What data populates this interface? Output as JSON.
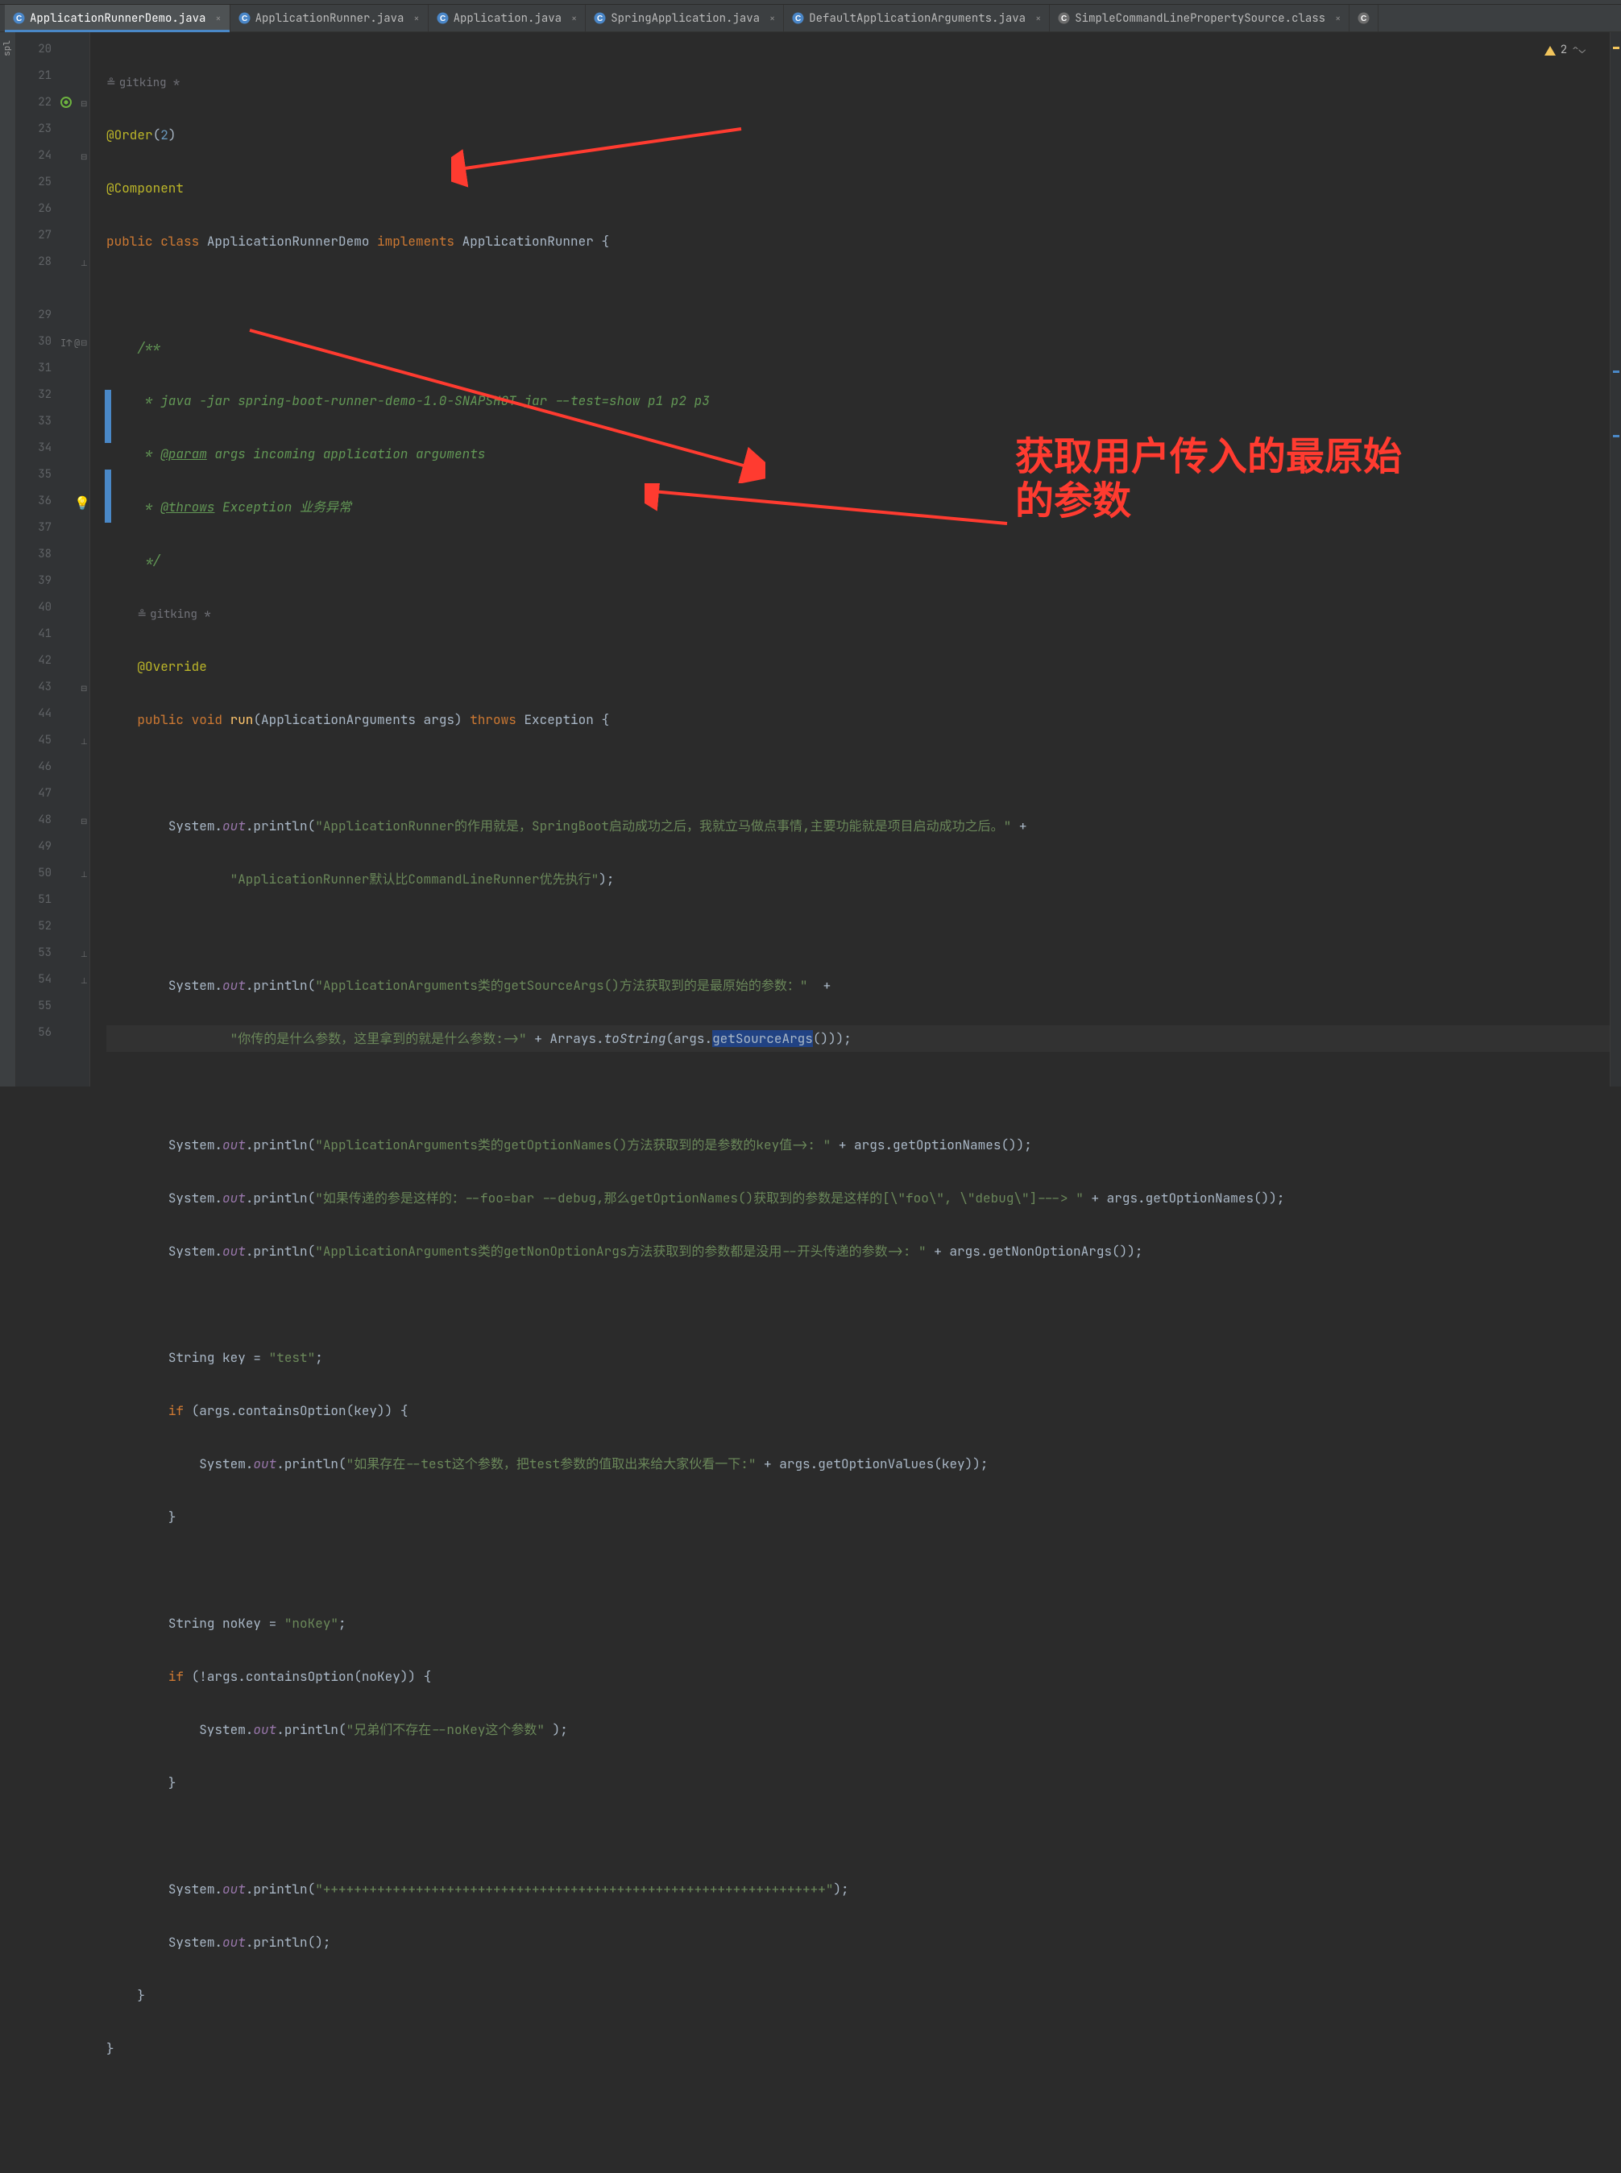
{
  "tabs": [
    {
      "label": "ApplicationRunnerDemo.java",
      "active": true,
      "pinned": true,
      "icon": "class"
    },
    {
      "label": "ApplicationRunner.java",
      "active": false,
      "pinned": false,
      "icon": "class"
    },
    {
      "label": "Application.java",
      "active": false,
      "pinned": false,
      "icon": "class"
    },
    {
      "label": "SpringApplication.java",
      "active": false,
      "pinned": false,
      "icon": "class"
    },
    {
      "label": "DefaultApplicationArguments.java",
      "active": false,
      "pinned": false,
      "icon": "class"
    },
    {
      "label": "SimpleCommandLinePropertySource.class",
      "active": false,
      "pinned": false,
      "icon": "lib"
    }
  ],
  "inspection": {
    "warnings": "2"
  },
  "left_tool": "spl",
  "gutter_lines": [
    "20",
    "21",
    "22",
    "23",
    "24",
    "25",
    "26",
    "27",
    "28",
    "",
    "29",
    "30",
    "31",
    "32",
    "33",
    "34",
    "35",
    "36",
    "37",
    "38",
    "39",
    "40",
    "41",
    "42",
    "43",
    "44",
    "45",
    "46",
    "47",
    "48",
    "49",
    "50",
    "51",
    "52",
    "53",
    "54",
    "55",
    "56"
  ],
  "author": {
    "name": "gitking *",
    "icon": "≗"
  },
  "code": {
    "l20": {
      "ann": "@Order",
      "paren_open": "(",
      "num": "2",
      "paren_close": ")"
    },
    "l21": {
      "ann": "@Component"
    },
    "l22": {
      "kw1": "public class ",
      "type": "ApplicationRunnerDemo ",
      "kw2": "implements ",
      "iface": "ApplicationRunner ",
      "brace": "{"
    },
    "l24": {
      "doc": "/**"
    },
    "l25": {
      "doc": " * java -jar spring-boot-runner-demo-1.0-SNAPSHOT.jar --test=show p1 p2 p3"
    },
    "l26": {
      "star": " * ",
      "tag": "@param",
      "rest": " args incoming application arguments"
    },
    "l27": {
      "star": " * ",
      "tag": "@throws",
      "rest": " Exception 业务异常"
    },
    "l28": {
      "doc": " */"
    },
    "l29": {
      "ann": "@Override"
    },
    "l30": {
      "kw1": "public void ",
      "fn": "run",
      "sig": "(ApplicationArguments args) ",
      "kw2": "throws ",
      "ex": "Exception ",
      "brace": "{"
    },
    "l32": {
      "sys": "System.",
      "out": "out",
      "pr": ".println(",
      "str": "\"ApplicationRunner的作用就是，SpringBoot启动成功之后，我就立马做点事情,主要功能就是项目启动成功之后。\"",
      "plus": " +"
    },
    "l33": {
      "str": "\"ApplicationRunner默认比CommandLineRunner优先执行\"",
      "end": ");"
    },
    "l35": {
      "sys": "System.",
      "out": "out",
      "pr": ".println(",
      "str": "\"ApplicationArguments类的getSourceArgs()方法获取到的是最原始的参数：\"",
      "plus": "  +"
    },
    "l36": {
      "str": "\"你传的是什么参数，这里拿到的就是什么参数:->\"",
      "plus": " + Arrays.",
      "ital": "toString",
      "open": "(args.",
      "sel": "getSourceArgs",
      "close": "()));"
    },
    "l38": {
      "sys": "System.",
      "out": "out",
      "pr": ".println(",
      "str": "\"ApplicationArguments类的getOptionNames()方法获取到的是参数的key值->: \"",
      "plus": " + args.getOptionNames());"
    },
    "l39": {
      "sys": "System.",
      "out": "out",
      "pr": ".println(",
      "str": "\"如果传递的参是这样的：--foo=bar --debug,那么getOptionNames()获取到的参数是这样的[\\\"foo\\\", \\\"debug\\\"]---> \"",
      "plus": " + args.getOptionNames());"
    },
    "l40": {
      "sys": "System.",
      "out": "out",
      "pr": ".println(",
      "str": "\"ApplicationArguments类的getNonOptionArgs方法获取到的参数都是没用--开头传递的参数->: \"",
      "plus": " + args.getNonOptionArgs());"
    },
    "l42": {
      "txt": "String key = ",
      "str": "\"test\"",
      "end": ";"
    },
    "l43": {
      "kw": "if ",
      "txt": "(args.containsOption(key)) {"
    },
    "l44": {
      "sys": "System.",
      "out": "out",
      "pr": ".println(",
      "str": "\"如果存在--test这个参数，把test参数的值取出来给大家伙看一下:\"",
      "plus": " + args.getOptionValues(key));"
    },
    "l45": {
      "brace": "}"
    },
    "l47": {
      "txt": "String noKey = ",
      "str": "\"noKey\"",
      "end": ";"
    },
    "l48": {
      "kw": "if ",
      "txt": "(!args.containsOption(noKey)) {"
    },
    "l49": {
      "sys": "System.",
      "out": "out",
      "pr": ".println(",
      "str": "\"兄弟们不存在--noKey这个参数\" ",
      "end": ");"
    },
    "l50": {
      "brace": "}"
    },
    "l52": {
      "sys": "System.",
      "out": "out",
      "pr": ".println(",
      "str": "\"+++++++++++++++++++++++++++++++++++++++++++++++++++++++++++++++++\"",
      "end": ");"
    },
    "l53": {
      "sys": "System.",
      "out": "out",
      "pr": ".println();"
    },
    "l54": {
      "brace": "}"
    },
    "l55": {
      "brace": "}"
    }
  },
  "annotation": {
    "line1": "获取用户传入的最原始",
    "line2": "的参数"
  }
}
